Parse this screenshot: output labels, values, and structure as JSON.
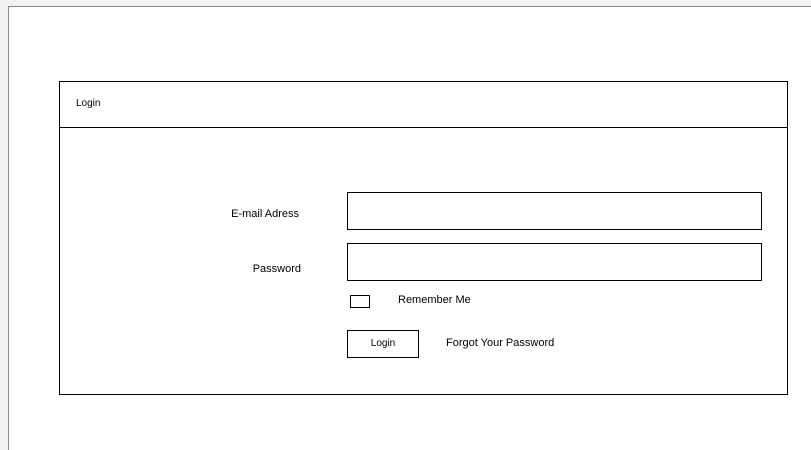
{
  "login_panel": {
    "title": "Login",
    "email": {
      "label": "E-mail Adress",
      "value": ""
    },
    "password": {
      "label": "Password",
      "value": ""
    },
    "remember_me": {
      "label": "Remember Me",
      "checked": false
    },
    "login_button_label": "Login",
    "forgot_password_label": "Forgot Your Password"
  }
}
